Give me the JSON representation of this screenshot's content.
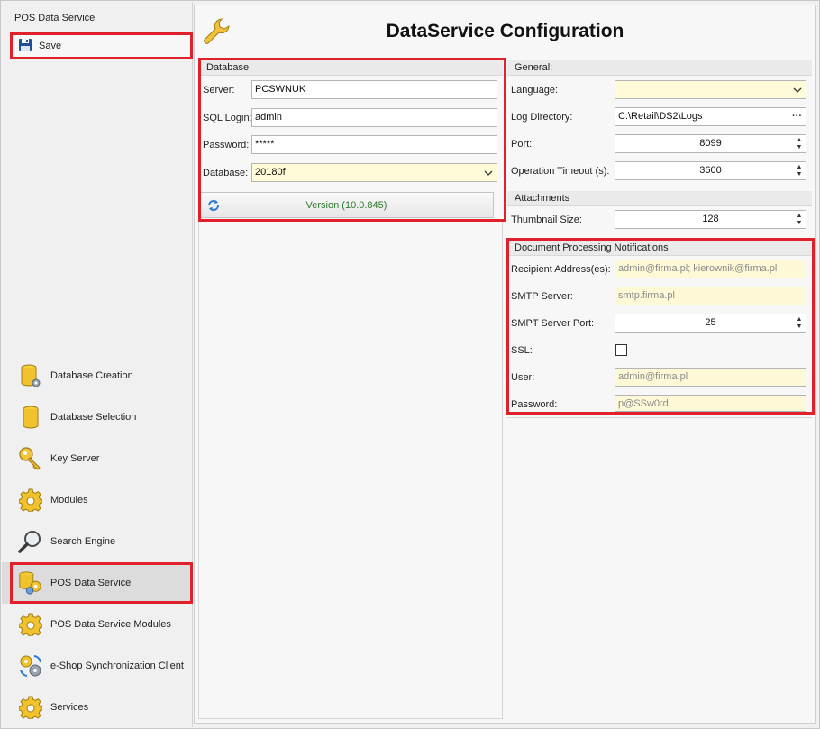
{
  "sidebar": {
    "title": "POS Data Service",
    "save_label": "Save",
    "items": [
      {
        "label": "Database Creation",
        "icon": "database-gear-icon"
      },
      {
        "label": "Database Selection",
        "icon": "database-icon"
      },
      {
        "label": "Key Server",
        "icon": "key-icon"
      },
      {
        "label": "Modules",
        "icon": "gear-icon"
      },
      {
        "label": "Search Engine",
        "icon": "magnifier-icon"
      },
      {
        "label": "POS Data Service",
        "icon": "database-gears-icon"
      },
      {
        "label": "POS Data Service Modules",
        "icon": "gear-icon"
      },
      {
        "label": "e-Shop Synchronization Client",
        "icon": "sync-gears-icon"
      },
      {
        "label": "Services",
        "icon": "gear-icon"
      }
    ],
    "active_item": "POS Data Service"
  },
  "header": {
    "title": "DataService Configuration",
    "icon": "wrench-icon"
  },
  "database": {
    "caption": "Database",
    "server_label": "Server:",
    "server_value": "PCSWNUK",
    "login_label": "SQL Login:",
    "login_value": "admin",
    "password_label": "Password:",
    "password_value": "*****",
    "database_label": "Database:",
    "database_value": "20180f",
    "version_label": "Version (10.0.845)"
  },
  "general": {
    "caption": "General:",
    "language_label": "Language:",
    "language_value": "",
    "logdir_label": "Log Directory:",
    "logdir_value": "C:\\Retail\\DS2\\Logs",
    "port_label": "Port:",
    "port_value": "8099",
    "timeout_label": "Operation Timeout (s):",
    "timeout_value": "3600"
  },
  "attachments": {
    "caption": "Attachments",
    "thumb_label": "Thumbnail Size:",
    "thumb_value": "128"
  },
  "notifications": {
    "caption": "Document Processing Notifications",
    "recipient_label": "Recipient Address(es):",
    "recipient_value": "admin@firma.pl; kierownik@firma.pl",
    "smtp_label": "SMTP Server:",
    "smtp_value": "smtp.firma.pl",
    "smtp_port_label": "SMPT Server Port:",
    "smtp_port_value": "25",
    "ssl_label": "SSL:",
    "ssl_checked": false,
    "user_label": "User:",
    "user_value": "admin@firma.pl",
    "password_label": "Password:",
    "password_value": "p@SSw0rd"
  },
  "colors": {
    "highlight": "#e0202b",
    "readonly_field": "#fdf9d6",
    "version_text": "#2d7b2d"
  }
}
